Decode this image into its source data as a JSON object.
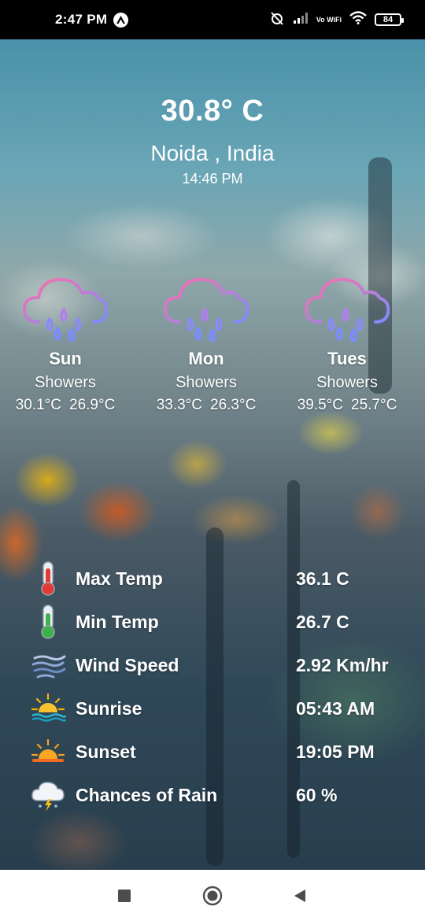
{
  "status_bar": {
    "time": "2:47 PM",
    "wifi_label": "Vo WiFi",
    "battery": "84"
  },
  "current": {
    "temperature": "30.8° C",
    "location": "Noida , India",
    "time": "14:46 PM"
  },
  "forecast": [
    {
      "day": "Sun",
      "condition": "Showers",
      "high": "30.1°C",
      "low": "26.9°C",
      "icon": "rain-cloud-icon"
    },
    {
      "day": "Mon",
      "condition": "Showers",
      "high": "33.3°C",
      "low": "26.3°C",
      "icon": "rain-cloud-icon"
    },
    {
      "day": "Tues",
      "condition": "Showers",
      "high": "39.5°C",
      "low": "25.7°C",
      "icon": "rain-cloud-icon"
    }
  ],
  "details": [
    {
      "label": "Max Temp",
      "value": "36.1 C",
      "icon": "thermometer-hot-icon"
    },
    {
      "label": "Min Temp",
      "value": "26.7 C",
      "icon": "thermometer-cold-icon"
    },
    {
      "label": "Wind Speed",
      "value": "2.92 Km/hr",
      "icon": "wind-icon"
    },
    {
      "label": "Sunrise",
      "value": "05:43 AM",
      "icon": "sunrise-icon"
    },
    {
      "label": "Sunset",
      "value": "19:05 PM",
      "icon": "sunset-icon"
    },
    {
      "label": "Chances of Rain",
      "value": "60 %",
      "icon": "storm-cloud-icon"
    }
  ],
  "colors": {
    "cloud_gradient_start": "#ff6fa8",
    "cloud_gradient_end": "#7b8cff",
    "text": "#ffffff"
  }
}
